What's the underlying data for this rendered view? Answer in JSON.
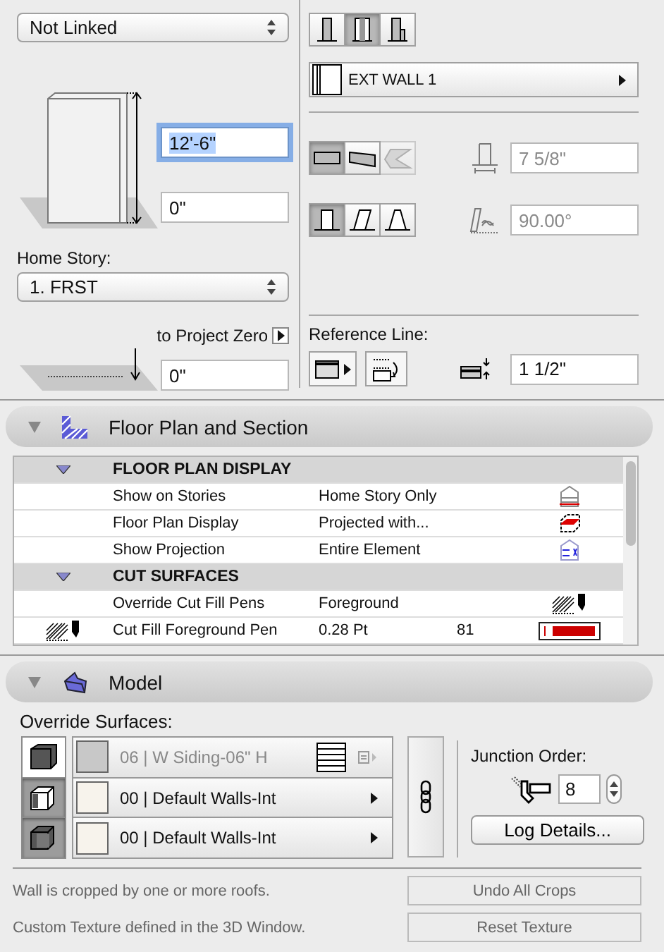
{
  "wall_top": {
    "value": "Not Linked"
  },
  "height_field": {
    "value": "12'-6\"",
    "selected": true
  },
  "bottom_offset": {
    "value": "0\""
  },
  "home_story": {
    "label": "Home Story:",
    "value": "1. FRST"
  },
  "project_zero": {
    "label": "to Project Zero",
    "value": "0\""
  },
  "structure_buttons": [
    {
      "selected": false
    },
    {
      "selected": true
    },
    {
      "selected": false
    }
  ],
  "composite": {
    "value": "EXT WALL 1"
  },
  "geometry_buttons": [
    {
      "selected": true,
      "disabled": false
    },
    {
      "selected": false,
      "disabled": false
    },
    {
      "selected": false,
      "disabled": true
    }
  ],
  "thickness": {
    "value": "7 5/8\"",
    "disabled": true
  },
  "slant_buttons": [
    {
      "selected": true
    },
    {
      "selected": false
    },
    {
      "selected": false
    }
  ],
  "angle": {
    "value": "90.00°",
    "disabled": true
  },
  "reference_line": {
    "label": "Reference Line:",
    "offset": "1 1/2\""
  },
  "floor_plan_panel": {
    "title": "Floor Plan and Section",
    "expanded": true,
    "rows": [
      {
        "kind": "group",
        "expanded": true,
        "name": "FLOOR PLAN DISPLAY"
      },
      {
        "kind": "item",
        "name": "Show on Stories",
        "value": "Home Story Only"
      },
      {
        "kind": "item",
        "name": "Floor Plan Display",
        "value": "Projected with..."
      },
      {
        "kind": "item",
        "name": "Show Projection",
        "value": "Entire Element"
      },
      {
        "kind": "group",
        "expanded": true,
        "name": "CUT SURFACES"
      },
      {
        "kind": "item",
        "name": "Override Cut Fill Pens",
        "value": "Foreground"
      },
      {
        "kind": "pen",
        "name": "Cut Fill Foreground Pen",
        "value": "0.28 Pt",
        "number": "81",
        "color": "#cc0000"
      }
    ]
  },
  "model_panel": {
    "title": "Model",
    "expanded": true
  },
  "override_surfaces": {
    "label": "Override Surfaces:",
    "rows": [
      {
        "selected": false,
        "disabled": true,
        "name": "06 | W Siding-06\" H",
        "color": "#c8c8c8"
      },
      {
        "selected": true,
        "disabled": false,
        "name": "00 | Default Walls-Int",
        "color": "#f7f3ec"
      },
      {
        "selected": true,
        "disabled": false,
        "name": "00 | Default Walls-Int",
        "color": "#f7f3ec"
      }
    ]
  },
  "junction": {
    "label": "Junction Order:",
    "value": "8",
    "button": "Log Details..."
  },
  "notices": [
    {
      "text": "Wall is cropped by one or more roofs.",
      "button": "Undo All Crops",
      "disabled": true
    },
    {
      "text": "Custom Texture defined in the 3D Window.",
      "button": "Reset Texture",
      "disabled": true
    }
  ]
}
